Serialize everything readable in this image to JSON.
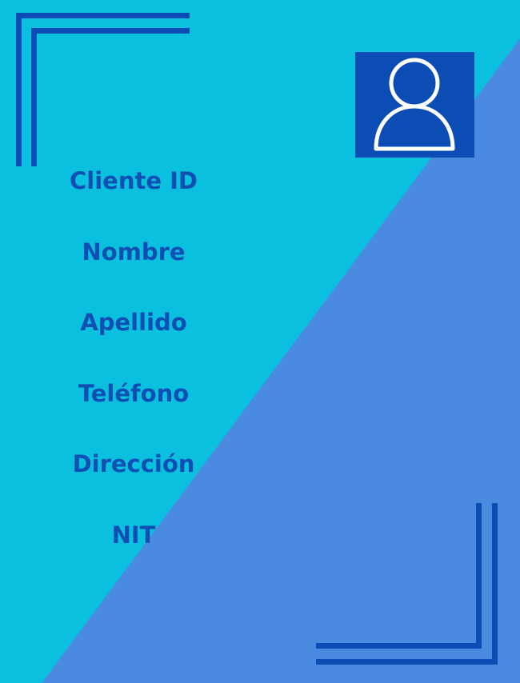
{
  "colors": {
    "background_light": "#0bbfdf",
    "background_dark": "#4a8ae0",
    "accent": "#0b4db5",
    "label_text": "#0e4fb3",
    "icon_stroke": "#ffffff"
  },
  "avatar": {
    "icon": "user-icon"
  },
  "fields": [
    {
      "label": "Cliente ID"
    },
    {
      "label": "Nombre"
    },
    {
      "label": "Apellido"
    },
    {
      "label": "Teléfono"
    },
    {
      "label": "Dirección"
    },
    {
      "label": "NIT"
    }
  ]
}
